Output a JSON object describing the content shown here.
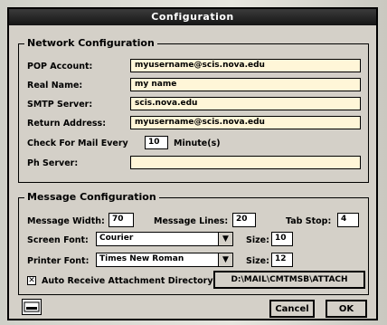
{
  "window": {
    "title": "Configuration"
  },
  "network": {
    "title": "Network Configuration",
    "pop_label": "POP Account:",
    "pop_value": "myusername@scis.nova.edu",
    "realname_label": "Real Name:",
    "realname_value": "my name",
    "smtp_label": "SMTP Server:",
    "smtp_value": "scis.nova.edu",
    "return_label": "Return Address:",
    "return_value": "myusername@scis.nova.edu",
    "check_label": "Check For Mail Every",
    "check_value": "10",
    "check_unit": "Minute(s)",
    "ph_label": "Ph Server:",
    "ph_value": ""
  },
  "message": {
    "title": "Message Configuration",
    "width_label": "Message Width:",
    "width_value": "70",
    "lines_label": "Message Lines:",
    "lines_value": "20",
    "tab_label": "Tab Stop:",
    "tab_value": "4",
    "screen_font_label": "Screen Font:",
    "screen_font_value": "Courier",
    "screen_size_label": "Size:",
    "screen_size_value": "10",
    "printer_font_label": "Printer Font:",
    "printer_font_value": "Times New Roman",
    "printer_size_label": "Size:",
    "printer_size_value": "12",
    "attach_checked": true,
    "attach_label": "Auto Receive Attachment Directory:",
    "attach_dir": "D:\\MAIL\\CMTMSB\\ATTACH"
  },
  "buttons": {
    "cancel": "Cancel",
    "ok": "OK"
  },
  "icons": {
    "app": "app-icon",
    "dropdown": "chevron-down-icon",
    "check": "checkbox-checked-icon"
  },
  "colors": {
    "field_bg": "#fff6d8",
    "titlebar": "#1a1a1a"
  }
}
